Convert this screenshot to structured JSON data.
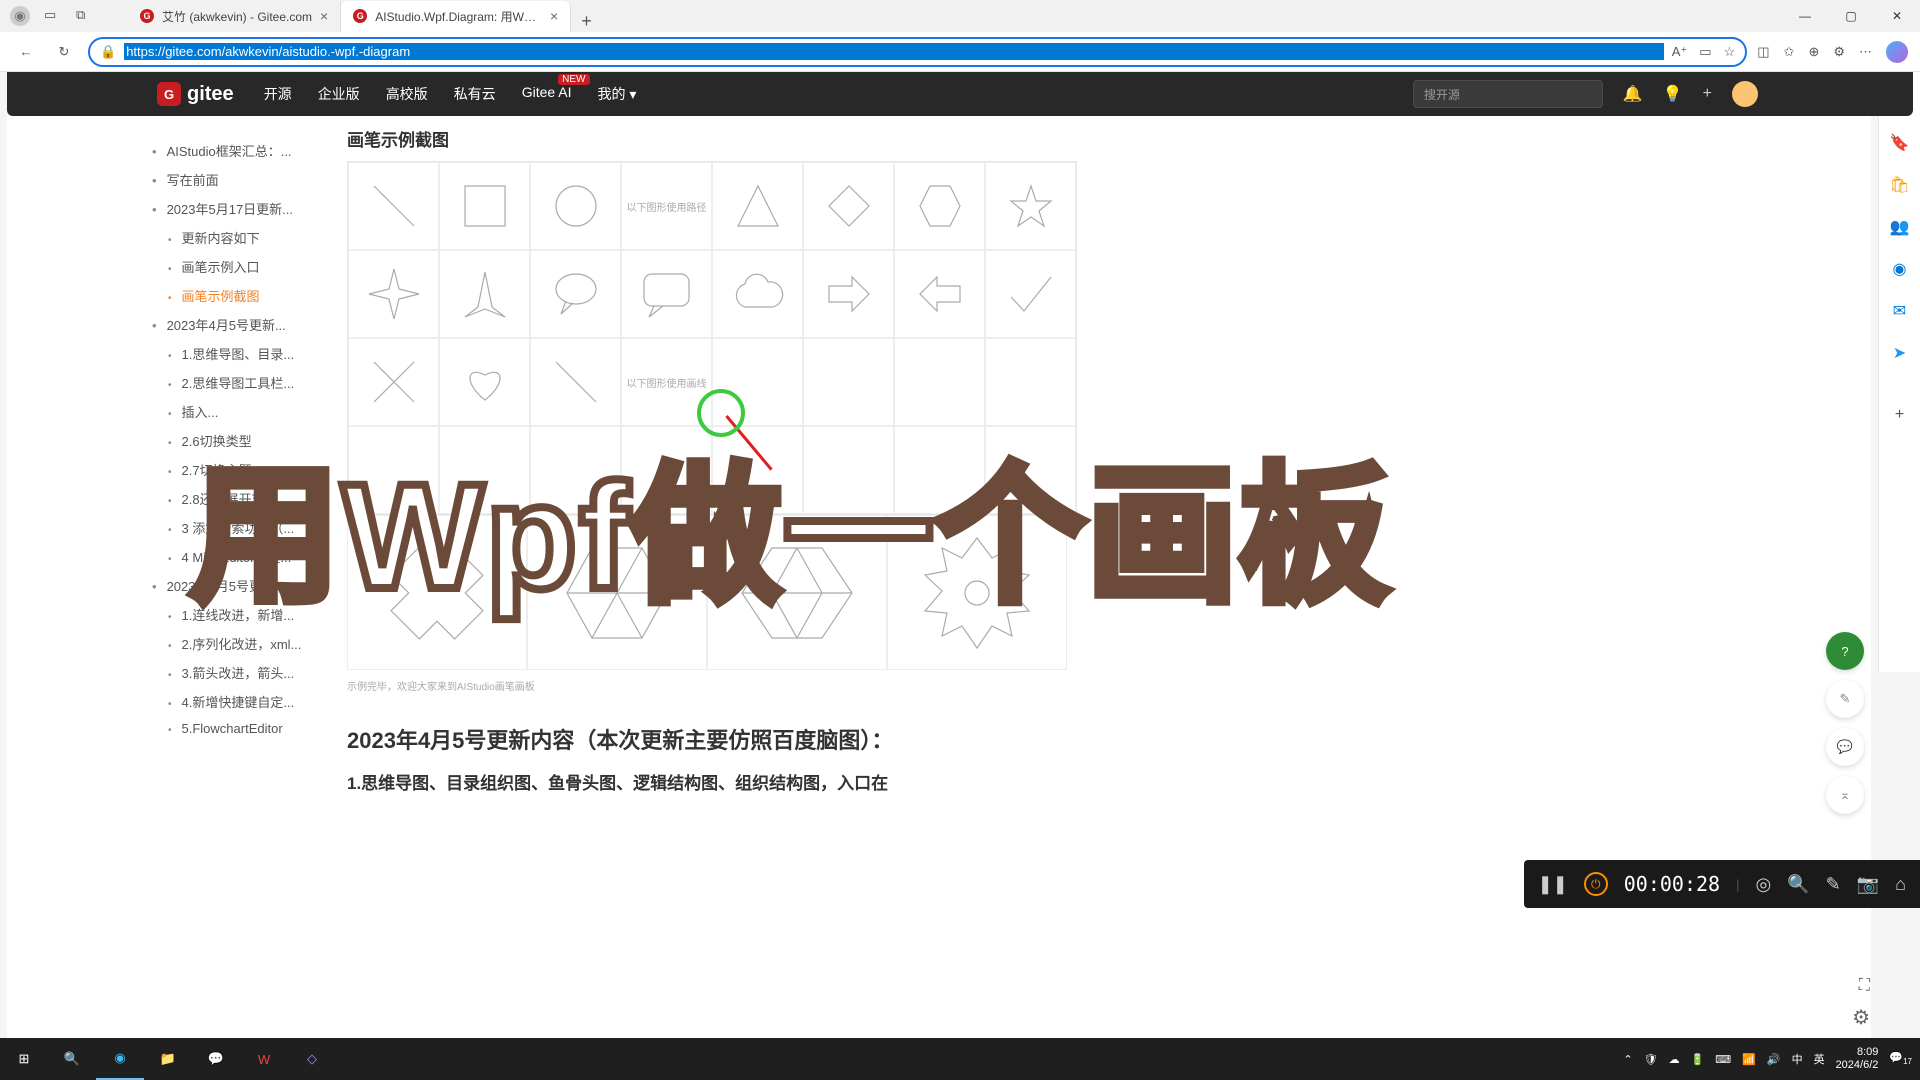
{
  "titlebar": {
    "tabs": [
      {
        "title": "艾竹 (akwkevin) - Gitee.com",
        "active": false
      },
      {
        "title": "AIStudio.Wpf.Diagram: 用Wpf做...",
        "active": true
      }
    ]
  },
  "addressbar": {
    "url": "https://gitee.com/akwkevin/aistudio.-wpf.-diagram"
  },
  "gitee_nav": {
    "brand": "gitee",
    "menu": [
      "开源",
      "企业版",
      "高校版",
      "私有云",
      "Gitee AI",
      "我的"
    ],
    "new_badge": "NEW",
    "search_placeholder": "搜开源"
  },
  "toc": {
    "items": [
      {
        "level": 1,
        "text": "AIStudio框架汇总：..."
      },
      {
        "level": 1,
        "text": "写在前面"
      },
      {
        "level": 1,
        "text": "2023年5月17日更新..."
      },
      {
        "level": 2,
        "text": "更新内容如下"
      },
      {
        "level": 2,
        "text": "画笔示例入口"
      },
      {
        "level": 2,
        "text": "画笔示例截图",
        "active": true
      },
      {
        "level": 1,
        "text": "2023年4月5号更新..."
      },
      {
        "level": 2,
        "text": "1.思维导图、目录..."
      },
      {
        "level": 2,
        "text": "2.思维导图工具栏..."
      },
      {
        "level": 2,
        "text": "插入..."
      },
      {
        "level": 2,
        "text": "2.6切换类型"
      },
      {
        "level": 2,
        "text": "2.7切换主题"
      },
      {
        "level": 2,
        "text": "2.8还有展开节点..."
      },
      {
        "level": 2,
        "text": "3 添加搜索功能（..."
      },
      {
        "level": 2,
        "text": "4 MindEditor：最..."
      },
      {
        "level": 1,
        "text": "2023年2月5号更新..."
      },
      {
        "level": 2,
        "text": "1.连线改进，新增..."
      },
      {
        "level": 2,
        "text": "2.序列化改进，xml..."
      },
      {
        "level": 2,
        "text": "3.箭头改进，箭头..."
      },
      {
        "level": 2,
        "text": "4.新增快捷键自定..."
      },
      {
        "level": 2,
        "text": "5.FlowchartEditor"
      }
    ]
  },
  "main": {
    "section_title": "画笔示例截图",
    "label_path": "以下图形使用路径",
    "label_line": "以下图形使用画线",
    "caption": "示例完毕，欢迎大家来到AIStudio画笔画板",
    "heading_2023": "2023年4月5号更新内容（本次更新主要仿照百度脑图）：",
    "sub_line": "1.思维导图、目录组织图、鱼骨头图、逻辑结构图、组织结构图，入口在"
  },
  "overlay": {
    "big_text": "用Wpf做一个画板"
  },
  "recording": {
    "time": "00:00:28"
  },
  "systray": {
    "ime1": "中",
    "ime2": "英",
    "time": "8:09",
    "date": "2024/6/2",
    "notif": "17"
  }
}
